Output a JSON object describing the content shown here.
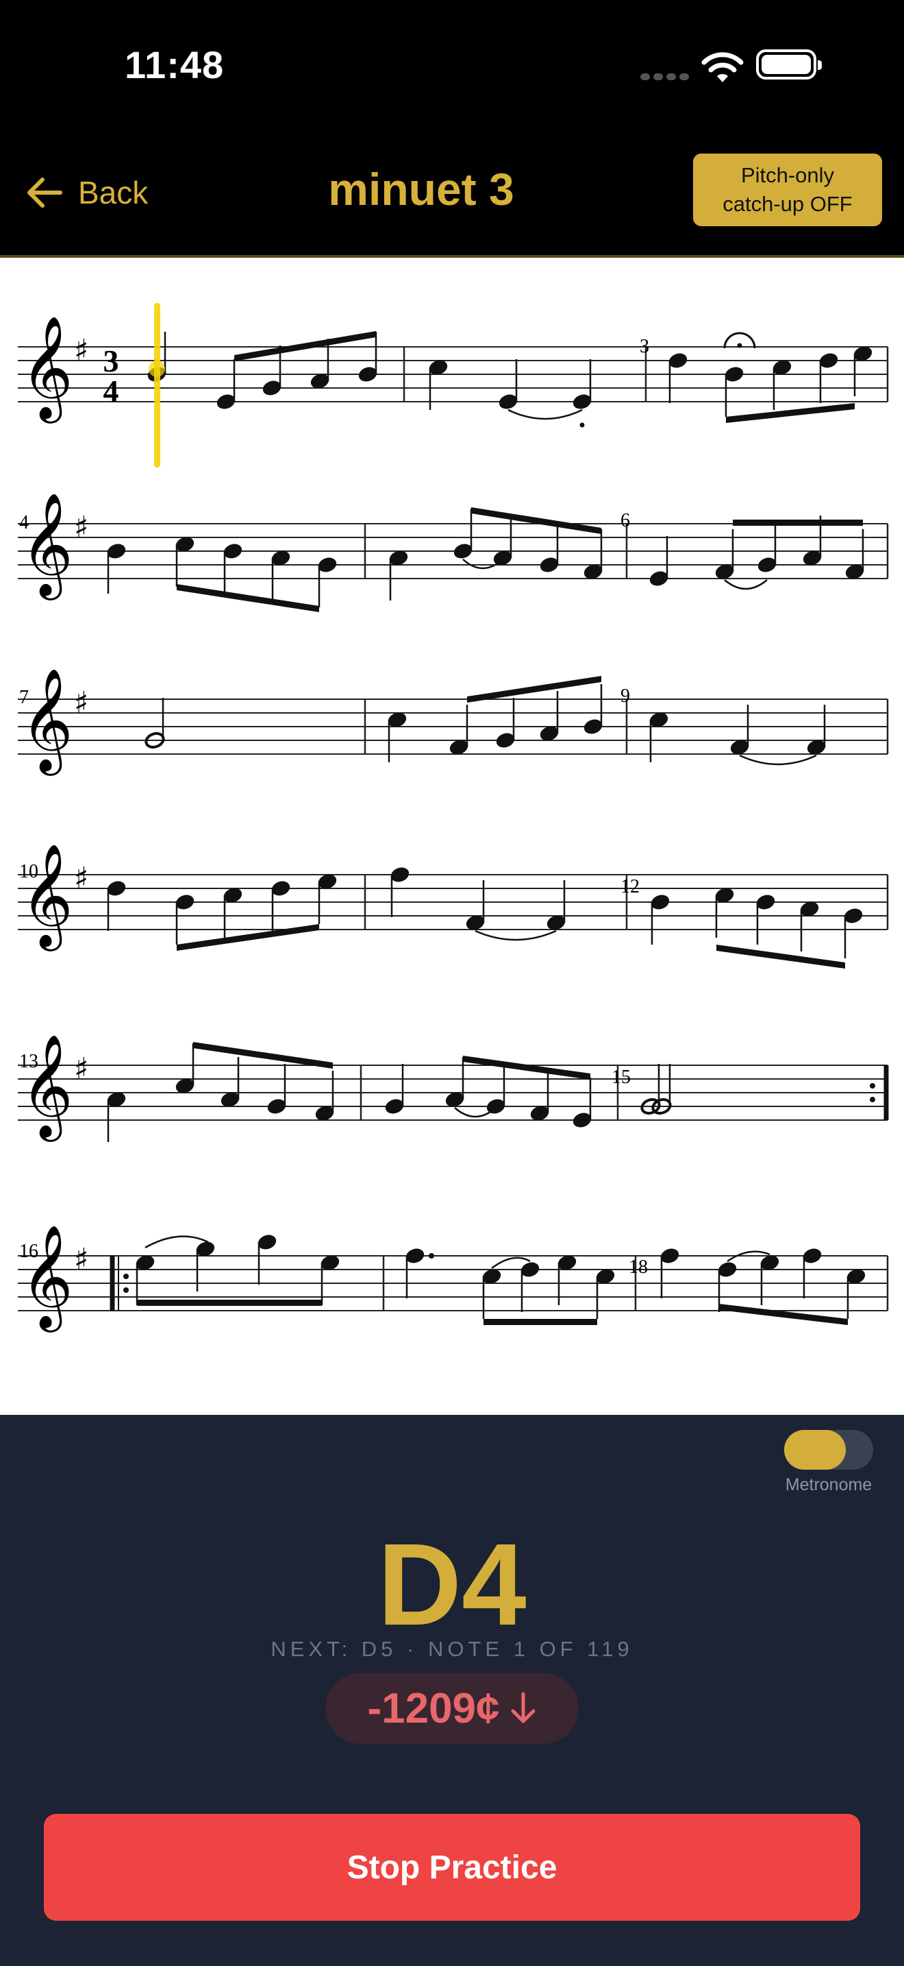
{
  "status_bar": {
    "time": "11:48",
    "icons": [
      "cellular-signal-icon",
      "wifi-icon",
      "battery-icon"
    ]
  },
  "nav": {
    "back_label": "Back",
    "title": "minuet 3",
    "pitch_toggle_line1": "Pitch-only",
    "pitch_toggle_line2": "catch-up OFF"
  },
  "score": {
    "time_signature": {
      "top": "3",
      "bottom": "4"
    },
    "key_signature": "G major (1 sharp)",
    "measure_numbers": [
      "3",
      "4",
      "6",
      "7",
      "9",
      "10",
      "12",
      "13",
      "15",
      "16",
      "18"
    ]
  },
  "practice": {
    "metronome_label": "Metronome",
    "metronome_on": true,
    "current_note": "D4",
    "next_info": "NEXT: D5 · NOTE 1 OF 119",
    "cents": "-1209¢",
    "stop_label": "Stop Practice"
  },
  "colors": {
    "accent": "#d4ae3a",
    "danger": "#ef4444",
    "panel": "#1b2334",
    "cursor": "#f5d10c"
  }
}
